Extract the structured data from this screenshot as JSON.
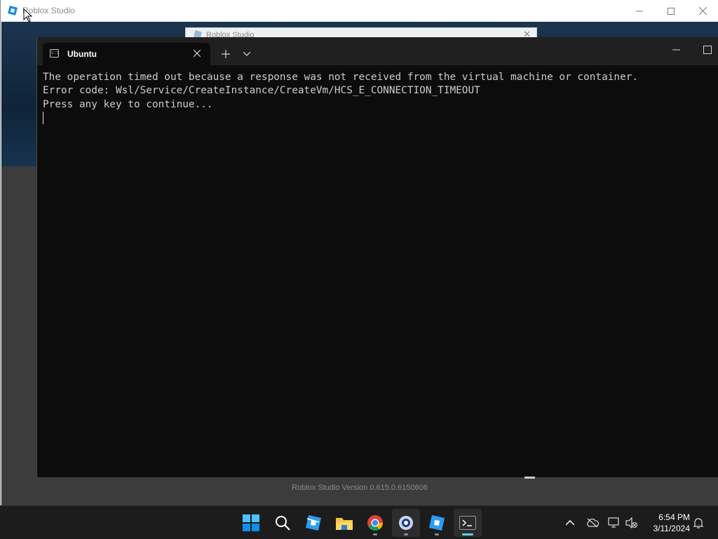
{
  "roblox": {
    "window_title": "Roblox Studio",
    "dialog_title": "Roblox Studio",
    "version_text": "Roblox Studio Version 0.615.0.6150606",
    "controls": {
      "minimize": "minimize-icon",
      "maximize": "maximize-icon",
      "close": "close-icon"
    }
  },
  "terminal": {
    "tab_label": "Ubuntu",
    "tab_icon": "terminal-icon",
    "output_lines": [
      "The operation timed out because a response was not received from the virtual machine or container.",
      "Error code: Wsl/Service/CreateInstance/CreateVm/HCS_E_CONNECTION_TIMEOUT",
      "Press any key to continue..."
    ],
    "colors": {
      "background": "#0c0c0c",
      "text": "#cccccc",
      "tabbar": "#202020"
    }
  },
  "taskbar": {
    "pinned": [
      {
        "name": "start-button",
        "icon": "windows-logo-icon"
      },
      {
        "name": "search-button",
        "icon": "search-icon"
      },
      {
        "name": "roblox-studio-taskbar-button",
        "icon": "roblox-studio-icon"
      },
      {
        "name": "file-explorer-taskbar-button",
        "icon": "folder-icon"
      },
      {
        "name": "chrome-taskbar-button",
        "icon": "chrome-icon"
      },
      {
        "name": "app-taskbar-button",
        "icon": "magnifier-app-icon"
      },
      {
        "name": "roblox-player-taskbar-button",
        "icon": "roblox-icon"
      },
      {
        "name": "terminal-taskbar-button",
        "icon": "terminal-icon"
      }
    ],
    "tray": {
      "icons": [
        "chevron-up-icon",
        "cloud-off-icon",
        "network-icon",
        "volume-muted-icon",
        "notification-bell-icon"
      ],
      "time": "6:54 PM",
      "date": "3/11/2024"
    },
    "accent": "#60cdff"
  }
}
